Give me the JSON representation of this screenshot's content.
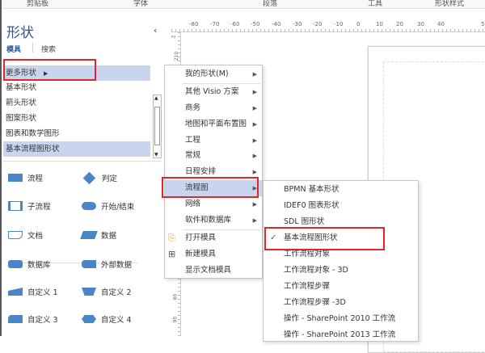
{
  "ribbon": {
    "groups": [
      "剪贴板",
      "字体",
      "段落",
      "工具",
      "形状样式"
    ]
  },
  "panel": {
    "title": "形状",
    "tabs": [
      "模具",
      "搜索"
    ],
    "collapse": "‹",
    "stencils": [
      "更多形状",
      "基本形状",
      "箭头形状",
      "图案形状",
      "图表和数学图形",
      "基本流程图形状"
    ],
    "shapes": [
      "流程",
      "判定",
      "子流程",
      "开始/结束",
      "文档",
      "数据",
      "数据库",
      "外部数据",
      "自定义 1",
      "自定义 2",
      "自定义 3",
      "自定义 4"
    ]
  },
  "ruler": {
    "top": [
      "-80",
      "-70",
      "-60",
      "-50",
      "-40",
      "-30",
      "-20",
      "-10",
      "0",
      "10",
      "20",
      "30",
      "40",
      "5"
    ],
    "left": [
      "2",
      "210",
      "80",
      "90"
    ]
  },
  "menu1": {
    "items": [
      "我的形状(M)",
      "其他 Visio 方案",
      "商务",
      "地图和平面布置图",
      "工程",
      "常规",
      "日程安排",
      "流程图",
      "网络",
      "软件和数据库"
    ],
    "actions": [
      "打开模具",
      "新建模具",
      "显示文档模具"
    ]
  },
  "menu2": {
    "items": [
      "BPMN 基本形状",
      "IDEF0 图表形状",
      "SDL 图形状",
      "基本流程图形状",
      "工作流程对象",
      "工作流程对象 - 3D",
      "工作流程步骤",
      "工作流程步骤 -3D",
      "操作 - SharePoint 2010 工作流",
      "操作 - SharePoint 2013 工作流"
    ],
    "checked": "✓"
  },
  "colors": {
    "accent": "#2b579a",
    "highlight": "#c9d5ef",
    "callout": "#e0252f"
  }
}
